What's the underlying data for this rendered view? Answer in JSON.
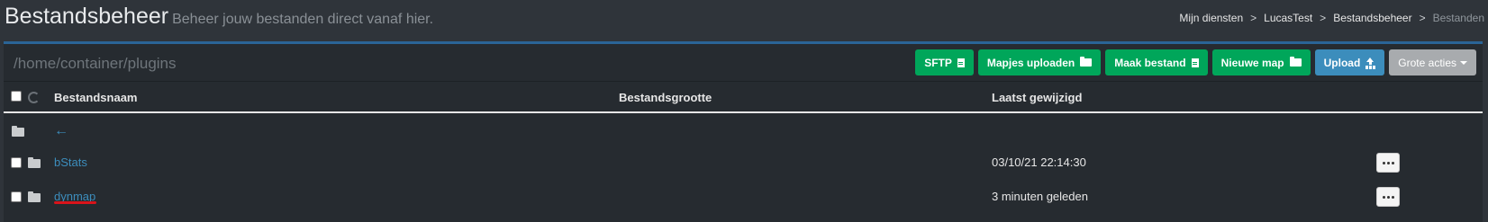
{
  "header": {
    "title": "Bestandsbeheer",
    "subtitle": "Beheer jouw bestanden direct vanaf hier."
  },
  "breadcrumb": {
    "items": [
      "Mijn diensten",
      "LucasTest",
      "Bestandsbeheer"
    ],
    "active": "Bestanden",
    "separator": ">"
  },
  "path": "/home/container/plugins",
  "toolbar": {
    "sftp": "SFTP",
    "upload_folders": "Mapjes uploaden",
    "make_file": "Maak bestand",
    "new_folder": "Nieuwe map",
    "upload": "Upload",
    "bulk_actions": "Grote acties"
  },
  "table": {
    "columns": [
      "Bestandsnaam",
      "Bestandsgrootte",
      "Laatst gewijzigd"
    ],
    "parent_link": "←",
    "rows": [
      {
        "name": "bStats",
        "size": "",
        "modified": "03/10/21 22:14:30",
        "type": "folder"
      },
      {
        "name": "dynmap",
        "size": "",
        "modified": "3 minuten geleden",
        "type": "folder"
      }
    ]
  },
  "colors": {
    "accent_blue": "#3c8dbc",
    "green": "#00a65a",
    "annotation_red": "#d9141b"
  }
}
